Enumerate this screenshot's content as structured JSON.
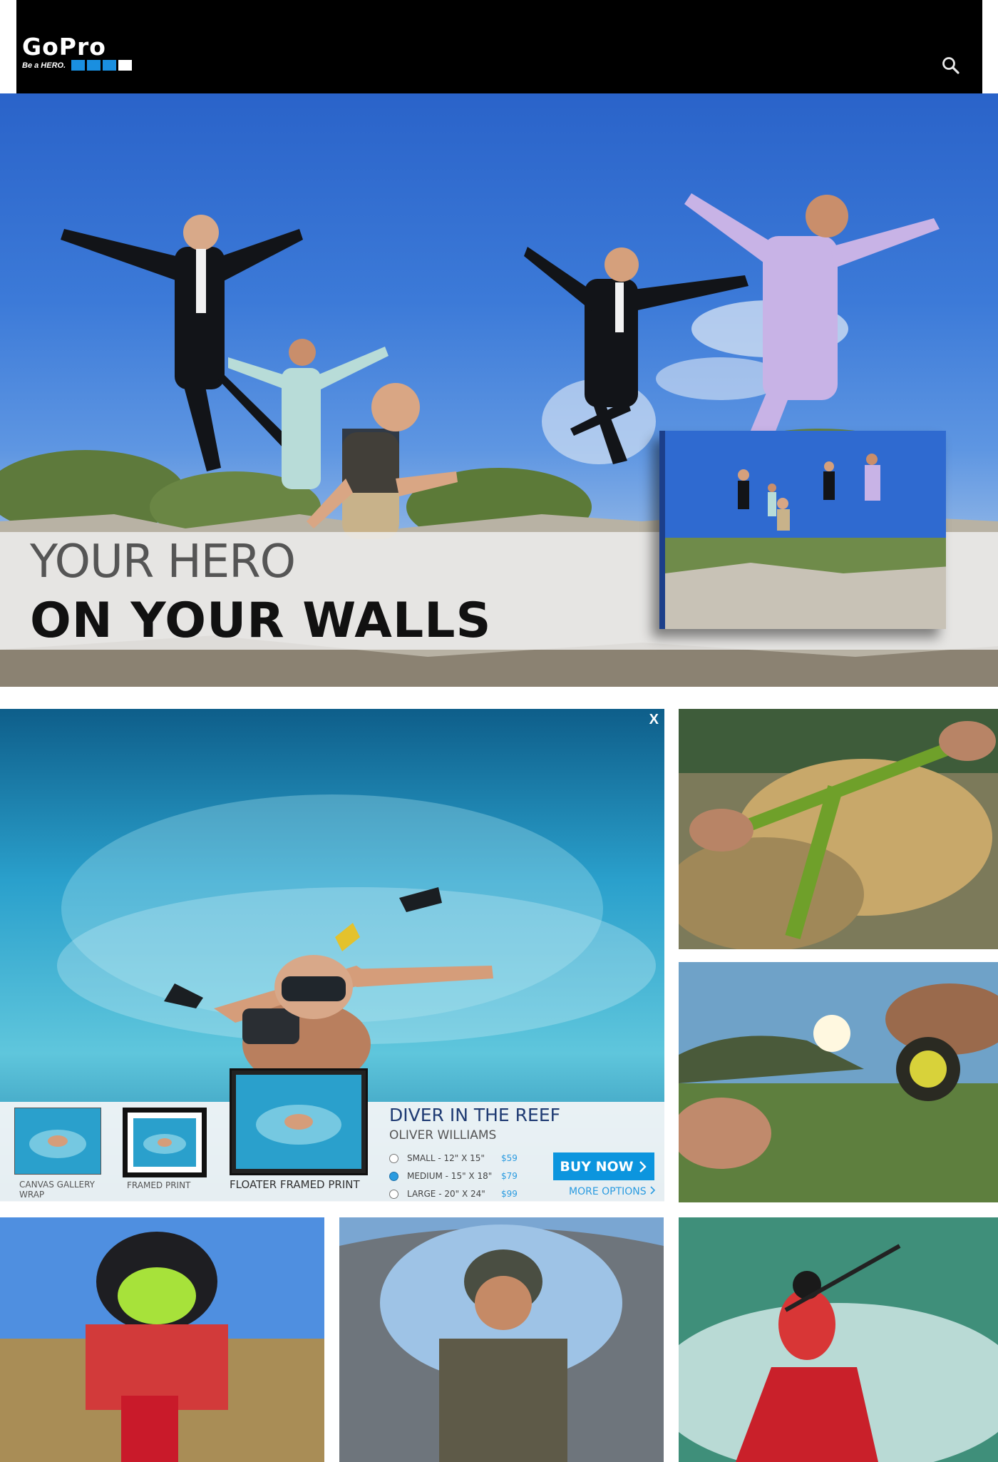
{
  "header": {
    "logo_word": "GoPro",
    "logo_tagline": "Be a HERO.",
    "logo_squares": [
      "#1a8fe0",
      "#1a8fe0",
      "#1a8fe0",
      "#ffffff"
    ],
    "search_icon": "search-icon"
  },
  "hero": {
    "title_line1": "YOUR HERO",
    "title_line2": "ON YOUR WALLS"
  },
  "featured": {
    "close_label": "X",
    "product_title": "DIVER IN THE REEF",
    "artist": "OLIVER WILLIAMS",
    "formats": [
      {
        "label": "CANVAS GALLERY\nWRAP"
      },
      {
        "label": "FRAMED PRINT"
      },
      {
        "label": "FLOATER FRAMED PRINT"
      }
    ],
    "selected_format": "FLOATER FRAMED PRINT",
    "sizes": [
      {
        "label": "SMALL - 12\" X 15\"",
        "price": "$59",
        "selected": false
      },
      {
        "label": "MEDIUM - 15\" X 18\"",
        "price": "$79",
        "selected": true
      },
      {
        "label": "LARGE - 20\" X 24\"",
        "price": "$99",
        "selected": false
      }
    ],
    "buy_label": "BUY NOW",
    "buy_icon": "chevron-right-icon",
    "more_label": "MORE OPTIONS"
  },
  "colors": {
    "accent": "#0c95de",
    "title_blue": "#1f3b73",
    "header_bg": "#000000"
  }
}
